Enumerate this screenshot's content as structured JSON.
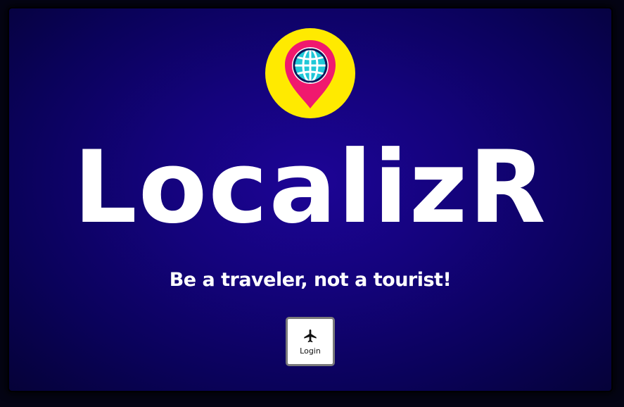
{
  "app": {
    "brand_name": "LocalizR",
    "tagline": "Be a traveler, not a tourist!"
  },
  "logo": {
    "icon": "globe-location-pin-icon",
    "colors": {
      "circle": "#ffea00",
      "pin": "#f0196e",
      "globe": "#1fc8d8"
    }
  },
  "login_button": {
    "label": "Login",
    "icon": "airplane-icon"
  },
  "colors": {
    "background_center": "#1d0496",
    "background_edge": "#050238",
    "text": "#ffffff"
  }
}
